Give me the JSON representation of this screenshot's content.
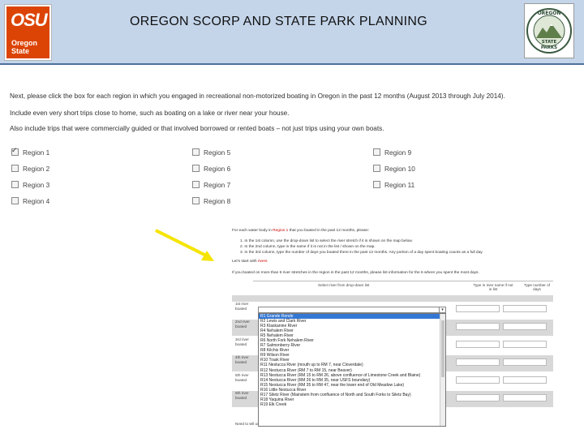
{
  "header": {
    "title": "OREGON SCORP AND STATE PARK PLANNING",
    "osu_logo_big": "OSU",
    "osu_logo_small": "Oregon State",
    "parks_logo_top": "OREGON",
    "parks_logo_bottom1": "STATE",
    "parks_logo_bottom2": "PARKS"
  },
  "question": {
    "line1": "Next, please click the box for each region in which you engaged in recreational non-motorized boating in Oregon in the past 12 months (August 2013 through July 2014).",
    "line2": "Include even very short trips close to home, such as boating on a lake or river near your house.",
    "line3": "Also include trips that were commercially guided or that involved borrowed or rented boats – not just trips using your own boats."
  },
  "regions": [
    {
      "label": "Region 1",
      "checked": true
    },
    {
      "label": "Region 2",
      "checked": false
    },
    {
      "label": "Region 3",
      "checked": false
    },
    {
      "label": "Region 4",
      "checked": false
    },
    {
      "label": "Region 5",
      "checked": false
    },
    {
      "label": "Region 6",
      "checked": false
    },
    {
      "label": "Region 7",
      "checked": false
    },
    {
      "label": "Region 8",
      "checked": false
    },
    {
      "label": "Region 9",
      "checked": false
    },
    {
      "label": "Region 10",
      "checked": false
    },
    {
      "label": "Region 11",
      "checked": false
    }
  ],
  "colors": {
    "header_bg": "#c4d5ea",
    "osu_orange": "#dc4405",
    "arrow": "#f5e400",
    "selected_option": "#3478d4"
  },
  "inset": {
    "intro_pre": "For each water body in ",
    "intro_region": "Region 1",
    "intro_post": " that you boated in the past 12 months, please:",
    "step1": "1.  In the 1st column, use the drop-down list to select the river stretch if it is shown on the map below.",
    "step2": "2.  In the 2nd column, type in the name if it is not in the list / shown on the map.",
    "step3": "3.  In the 3rd column, type the number of days you boated there in the past 12 months. Any portion of a day spent boating counts as a full day.",
    "start_pre": "Let's start with ",
    "start_red": "rivers",
    "multi": "If you boated on more than 6 river stretches in the region in the past 12 months, please list information for the 6 where you spent the most days.",
    "col1": "Select river from drop-down list",
    "col2": "Type in river name if not in list",
    "col3": "Type number of days",
    "row_labels": [
      "1st river boated",
      "2nd river boated",
      "3rd river boated",
      "4th river boated",
      "5th river boated",
      "6th river boated"
    ],
    "last_label": "Need to tell us",
    "dropdown_options": [
      "R1 Grande Ronde",
      "R2 Lewis and Clark River",
      "R3 Klaskanine River",
      "R4 Nehalem River",
      "R5 Nehalem River",
      "R6 North Fork Nehalem River",
      "R7 Salmonberry River",
      "R8 Kilchis River",
      "R9 Wilson River",
      "R10 Trask River",
      "R11 Nestucca River (mouth up to RM 7, near Cloverdale)",
      "R12 Nestucca River (RM 7 to RM 15, near Beaver)",
      "R13 Nestucca River (RM 15 to RM 26, above confluence of Limestone Creek and Blaine)",
      "R14 Nestucca River (RM 26 to RM 35, near USFS boundary)",
      "R15 Nestucca River (RM 35 to RM 47, near the lower end of Old Meadow Lake)",
      "R16 Little Nestucca River",
      "R17 Siletz River (Mainstem from confluence of North and South Forks to Siletz Bay)",
      "R18 Yaquina River",
      "R19 Elk Creek"
    ]
  }
}
